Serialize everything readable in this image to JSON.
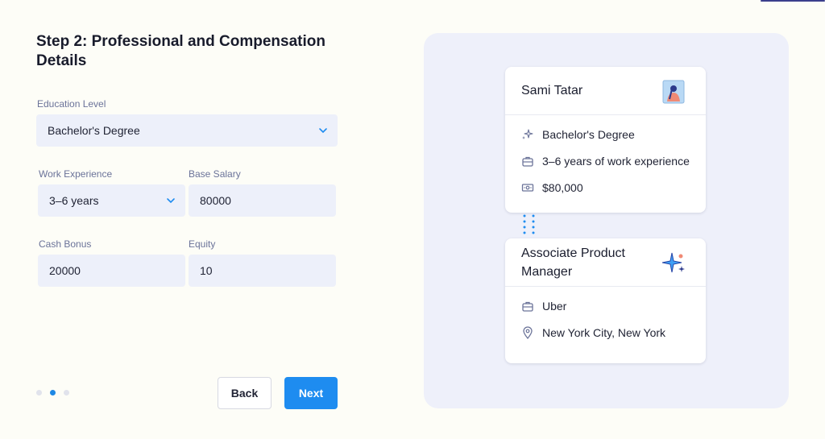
{
  "form": {
    "title": "Step 2: Professional and Compensation Details",
    "education": {
      "label": "Education Level",
      "value": "Bachelor's Degree"
    },
    "experience": {
      "label": "Work Experience",
      "value": "3–6 years"
    },
    "salary": {
      "label": "Base Salary",
      "value": "80000"
    },
    "bonus": {
      "label": "Cash Bonus",
      "value": "20000"
    },
    "equity": {
      "label": "Equity",
      "value": "10"
    },
    "steps": {
      "total": 3,
      "current": 2
    },
    "back_label": "Back",
    "next_label": "Next"
  },
  "preview": {
    "person": {
      "name": "Sami Tatar",
      "avatar_icon": "person-portrait-icon",
      "education": "Bachelor's Degree",
      "experience": "3–6 years of work experience",
      "salary": "$80,000"
    },
    "job": {
      "title_line1": "Associate Product",
      "title_line2": "Manager",
      "icon": "sparkle-icon",
      "company": "Uber",
      "location": "New York City, New York"
    }
  },
  "colors": {
    "accent": "#1e8cf0",
    "background": "#fdfdf7",
    "field": "#edf0fa",
    "preview_bg": "#eef0fa"
  }
}
